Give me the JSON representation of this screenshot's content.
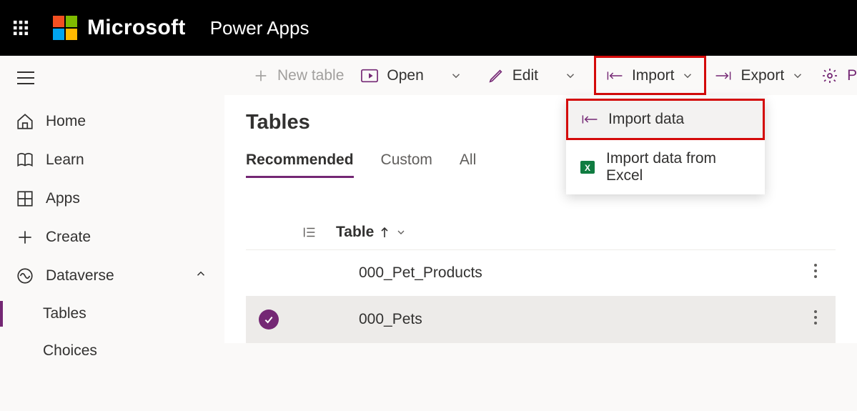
{
  "header": {
    "brand": "Microsoft",
    "app": "Power Apps"
  },
  "sidebar": {
    "items": [
      {
        "label": "Home"
      },
      {
        "label": "Learn"
      },
      {
        "label": "Apps"
      },
      {
        "label": "Create"
      },
      {
        "label": "Dataverse",
        "expanded": true
      },
      {
        "label": "Tables",
        "sub": true,
        "active": true
      },
      {
        "label": "Choices",
        "sub": true
      }
    ]
  },
  "cmdbar": {
    "new_table": "New table",
    "open": "Open",
    "edit": "Edit",
    "import": "Import",
    "export": "Export",
    "properties": "Proper"
  },
  "import_menu": {
    "import_data": "Import data",
    "import_excel": "Import data from Excel"
  },
  "page": {
    "title": "Tables",
    "tabs": {
      "recommended": "Recommended",
      "custom": "Custom",
      "all": "All"
    },
    "column_header": "Table",
    "rows": [
      {
        "name": "000_Pet_Products",
        "selected": false
      },
      {
        "name": "000_Pets",
        "selected": true
      }
    ]
  }
}
